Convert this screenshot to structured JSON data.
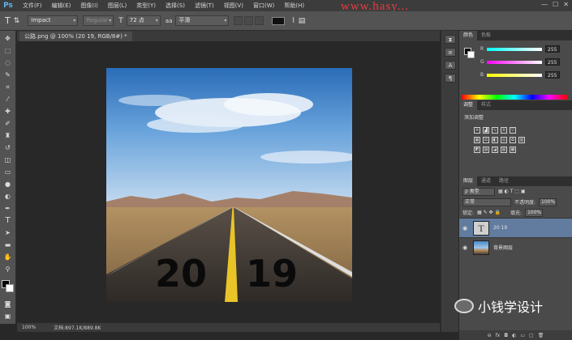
{
  "app": {
    "logo": "Ps"
  },
  "menu": [
    "文件(F)",
    "编辑(E)",
    "图像(I)",
    "图层(L)",
    "类型(Y)",
    "选择(S)",
    "滤镜(T)",
    "视图(V)",
    "窗口(W)",
    "帮助(H)"
  ],
  "watermark": "www.hasy...",
  "options": {
    "font_family": "Impact",
    "font_style": "Regular",
    "font_size": "72 点",
    "anti_alias": "平滑",
    "text_color": "#111111"
  },
  "document": {
    "tab_title": "公路.png @ 100% (20 19, RGB/8#) *"
  },
  "status": {
    "zoom": "100%",
    "doc_size": "文档:897.1K/889.8K"
  },
  "image": {
    "year_left": "20",
    "year_right": "19"
  },
  "panels": {
    "color_tabs": [
      "颜色",
      "色板"
    ],
    "rgb": [
      {
        "label": "R",
        "value": "255"
      },
      {
        "label": "G",
        "value": "255"
      },
      {
        "label": "B",
        "value": "255"
      }
    ],
    "adj_tabs": [
      "调整",
      "样式"
    ],
    "adj_label": "添加调整",
    "layers_tabs": [
      "图层",
      "通道",
      "路径"
    ],
    "kind_label": "ρ 类型",
    "blend_mode": "正常",
    "opacity_label": "不透明度:",
    "opacity_value": "100%",
    "lock_label": "锁定:",
    "fill_label": "填充:",
    "fill_value": "100%",
    "layers": [
      {
        "name": "20  19",
        "type": "text",
        "selected": true
      },
      {
        "name": "背景图层",
        "type": "image",
        "selected": false
      }
    ]
  },
  "brand": "小钱学设计"
}
